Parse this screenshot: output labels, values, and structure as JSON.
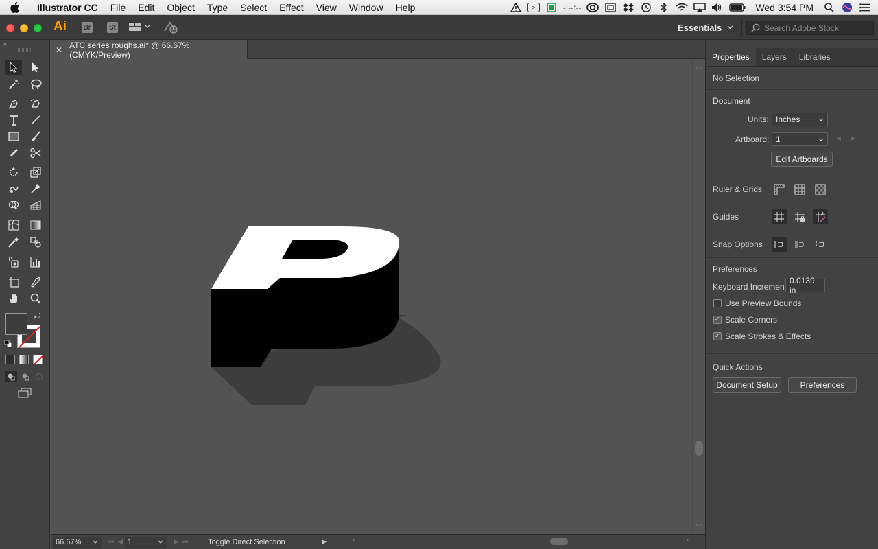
{
  "menubar": {
    "app_name": "Illustrator CC",
    "menus": [
      "File",
      "Edit",
      "Object",
      "Type",
      "Select",
      "Effect",
      "View",
      "Window",
      "Help"
    ],
    "clock": "Wed 3:54 PM",
    "status_text": "-:--:--"
  },
  "appbar": {
    "logo": "Ai",
    "bridge_label": "Br",
    "stock_label": "St",
    "workspace": "Essentials",
    "search_placeholder": "Search Adobe Stock"
  },
  "document": {
    "tab_title": "ATC series roughs.ai* @ 66.67% (CMYK/Preview)",
    "artwork_glyph": "P"
  },
  "statusbar": {
    "zoom": "66.67%",
    "artboard": "1",
    "status": "Toggle Direct Selection"
  },
  "panel": {
    "tabs": [
      "Properties",
      "Layers",
      "Libraries"
    ],
    "selection": "No Selection",
    "document_header": "Document",
    "units_label": "Units:",
    "units_value": "Inches",
    "artboard_label": "Artboard:",
    "artboard_value": "1",
    "edit_artboards": "Edit Artboards",
    "ruler_grids": "Ruler & Grids",
    "guides": "Guides",
    "snap_options": "Snap Options",
    "preferences_header": "Preferences",
    "keyboard_increment_label": "Keyboard Increment:",
    "keyboard_increment_value": "0.0139 in",
    "use_preview_bounds": "Use Preview Bounds",
    "use_preview_bounds_checked": false,
    "scale_corners": "Scale Corners",
    "scale_corners_checked": true,
    "scale_strokes": "Scale Strokes & Effects",
    "scale_strokes_checked": true,
    "quick_actions": "Quick Actions",
    "document_setup": "Document Setup",
    "preferences_btn": "Preferences"
  },
  "colors": {
    "accent_logo": "#ff9a00",
    "canvas": "#535353",
    "panel": "#424242"
  }
}
